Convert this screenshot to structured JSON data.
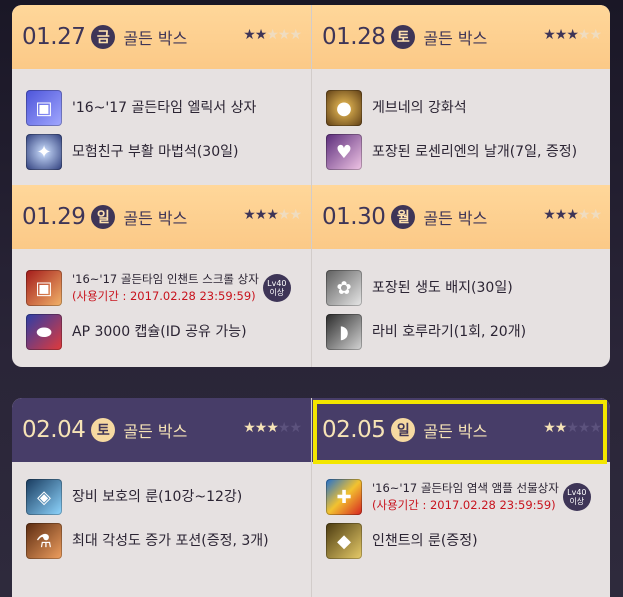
{
  "badge": {
    "line1": "Lv40",
    "line2": "이상"
  },
  "days": [
    {
      "date": "01.27",
      "weekday": "금",
      "box": "골든 박스",
      "stars_filled": 2,
      "stars_total": 5,
      "items": [
        {
          "icon": "gift-box-icon",
          "text": "'16~'17 골든타임 엘릭서 상자"
        },
        {
          "icon": "revive-stone-icon",
          "text": "모험친구 부활 마법석(30일)"
        }
      ]
    },
    {
      "date": "01.28",
      "weekday": "토",
      "box": "골든 박스",
      "stars_filled": 3,
      "stars_total": 5,
      "items": [
        {
          "icon": "gold-orb-icon",
          "text": "게브네의 강화석"
        },
        {
          "icon": "wing-package-icon",
          "text": "포장된 로센리엔의 날개(7일, 증정)"
        }
      ]
    },
    {
      "date": "01.29",
      "weekday": "일",
      "box": "골든 박스",
      "stars_filled": 3,
      "stars_total": 5,
      "items": [
        {
          "icon": "red-gift-box-icon",
          "text": "'16~'17 골든타임 인챈트 스크롤 상자",
          "period": "(사용기간 : 2017.02.28 23:59:59)",
          "badge": true
        },
        {
          "icon": "capsule-icon",
          "text": "AP 3000 캡슐(ID 공유 가능)"
        }
      ]
    },
    {
      "date": "01.30",
      "weekday": "월",
      "box": "골든 박스",
      "stars_filled": 3,
      "stars_total": 5,
      "items": [
        {
          "icon": "badge-package-icon",
          "text": "포장된 생도 배지(30일)"
        },
        {
          "icon": "whistle-icon",
          "text": "라비 호루라기(1회, 20개)"
        }
      ]
    },
    {
      "date": "02.04",
      "weekday": "토",
      "box": "골든 박스",
      "stars_filled": 3,
      "stars_total": 5,
      "items": [
        {
          "icon": "protection-rune-icon",
          "text": "장비 보호의 룬(10강~12강)"
        },
        {
          "icon": "potion-icon",
          "text": "최대 각성도 증가 포션(증정, 3개)"
        }
      ]
    },
    {
      "date": "02.05",
      "weekday": "일",
      "box": "골든 박스",
      "stars_filled": 2,
      "stars_total": 5,
      "items": [
        {
          "icon": "dye-ampoule-box-icon",
          "text": "'16~'17 골든타임 염색 앰플 선물상자",
          "period": "(사용기간 : 2017.02.28 23:59:59)",
          "badge": true
        },
        {
          "icon": "enchant-rune-icon",
          "text": "인챈트의 룬(증정)"
        }
      ]
    }
  ],
  "colors": {
    "accent_gold": "#fbc987",
    "accent_purple": "#473d68",
    "highlight": "#f3e600",
    "period_red": "#c8141e"
  }
}
